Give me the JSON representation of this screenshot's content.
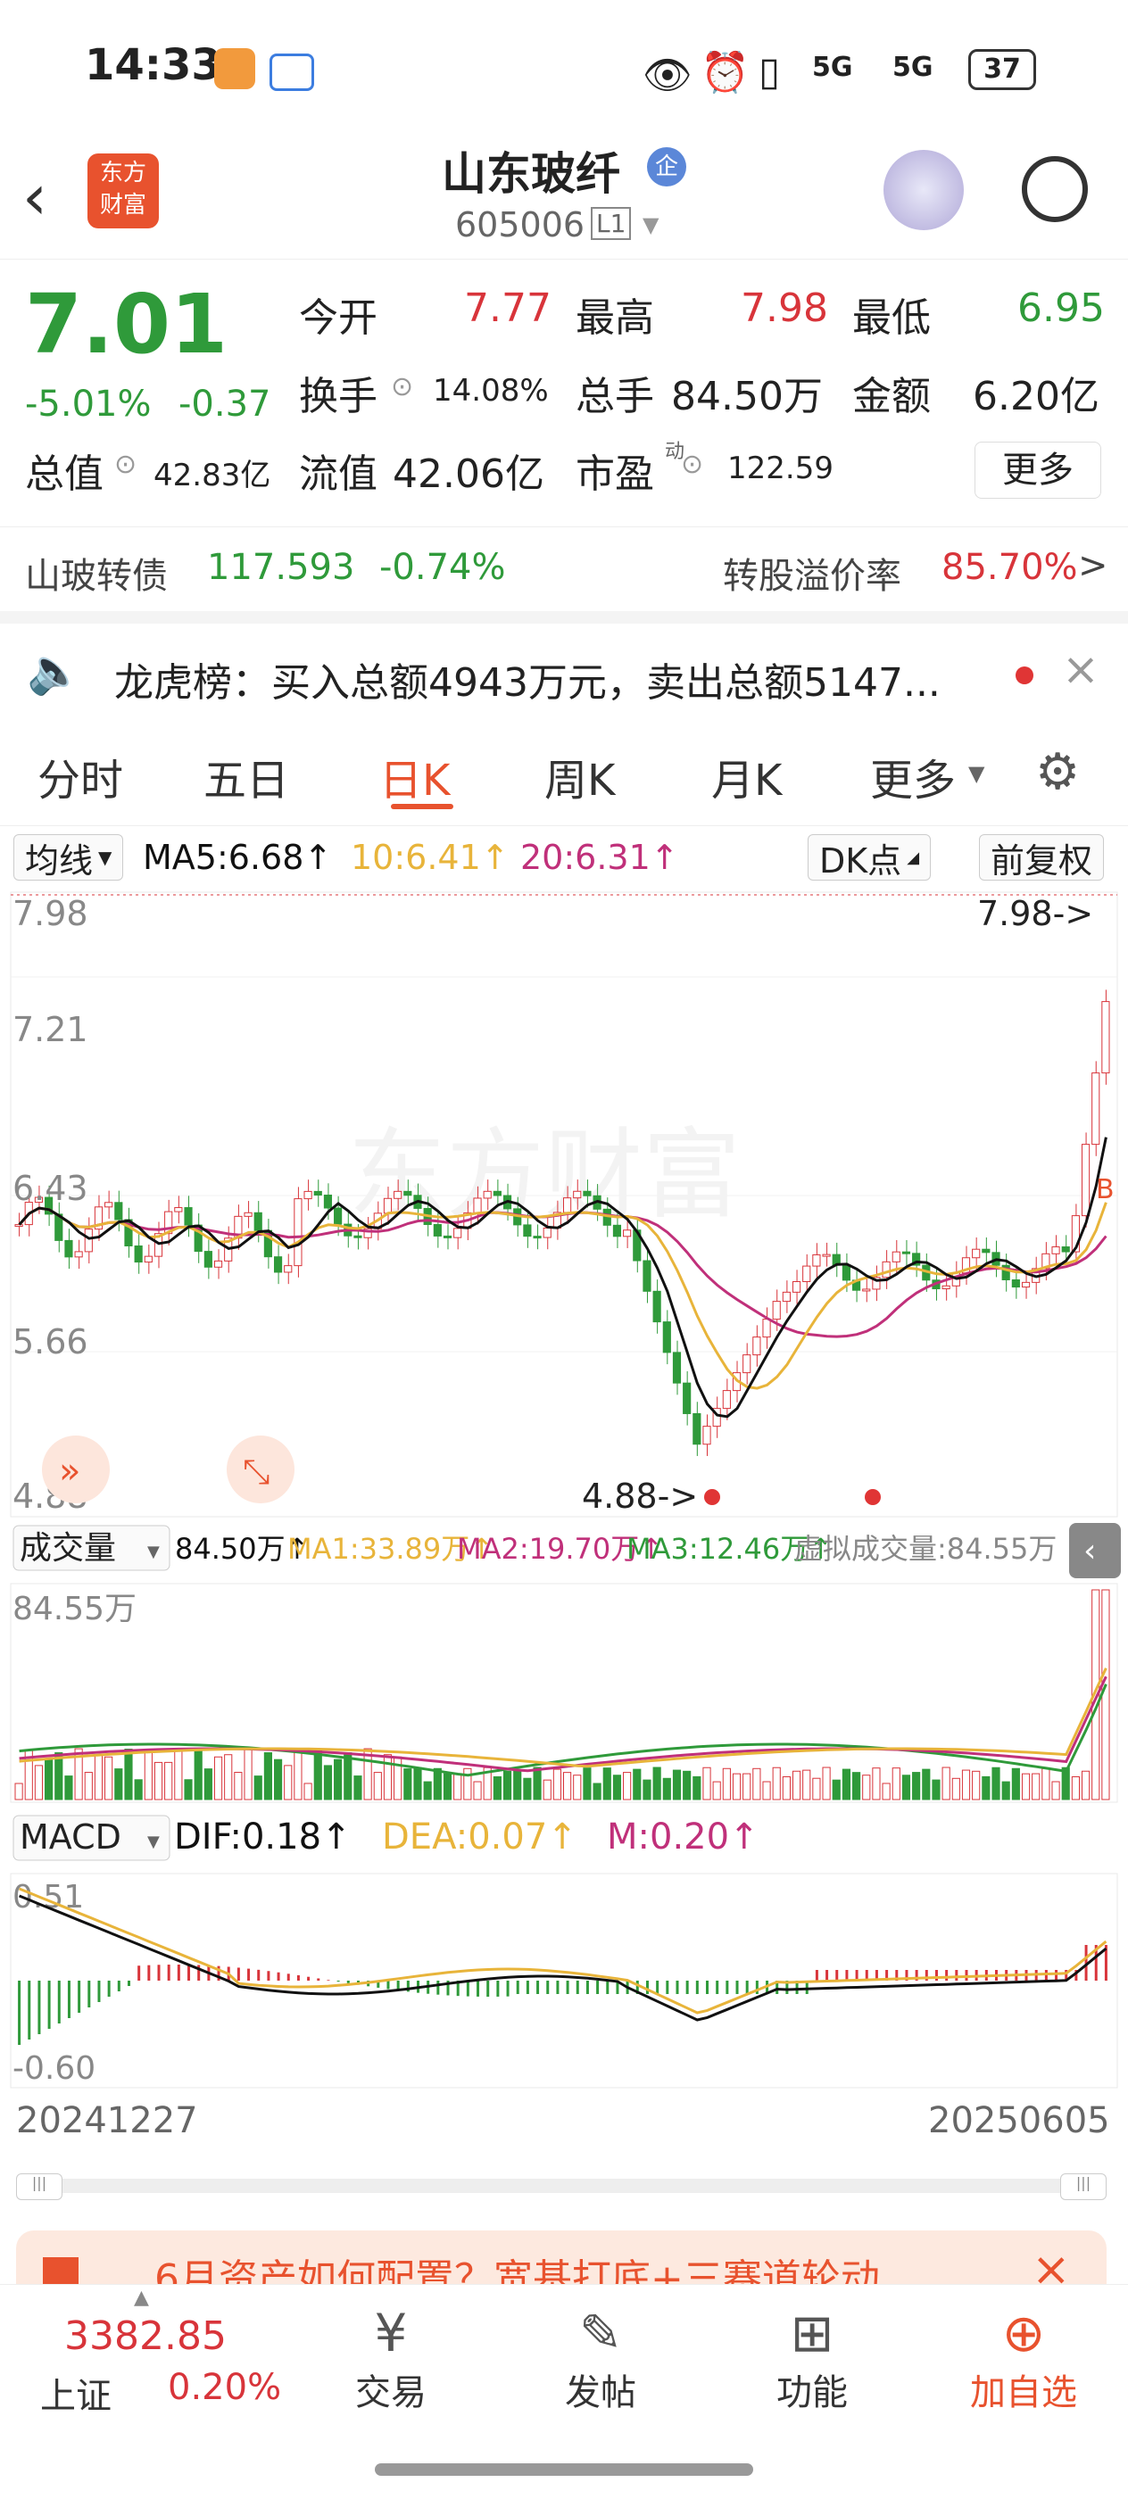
{
  "status": {
    "time": "14:33",
    "battery": "37",
    "signal1": "5G",
    "signal2": "5G"
  },
  "header": {
    "stock_name": "山东玻纤",
    "badge": "企",
    "code": "605006",
    "level": "L1",
    "logo_line1": "东方",
    "logo_line2": "财富"
  },
  "quote": {
    "price": "7.01",
    "change_pct": "-5.01%",
    "change": "-0.37",
    "open_label": "今开",
    "open": "7.77",
    "high_label": "最高",
    "high": "7.98",
    "low_label": "最低",
    "low": "6.95",
    "turnover_label": "换手",
    "turnover": "14.08%",
    "volume_label": "总手",
    "volume": "84.50万",
    "amount_label": "金额",
    "amount": "6.20亿",
    "mcap_label": "总值",
    "mcap": "42.83亿",
    "float_label": "流值",
    "float": "42.06亿",
    "pe_label": "市盈",
    "pe_sup": "动",
    "pe": "122.59",
    "more": "更多"
  },
  "bond": {
    "name": "山玻转债",
    "price": "117.593",
    "change": "-0.74%",
    "premium_label": "转股溢价率",
    "premium": "85.70%",
    "arrow": ">"
  },
  "notice": {
    "text": "龙虎榜：买入总额4943万元，卖出总额5147..."
  },
  "tabs": [
    "分时",
    "五日",
    "日K",
    "周K",
    "月K",
    "更多"
  ],
  "kline": {
    "ma_label": "均线",
    "ma5": "MA5:6.68↑",
    "ma10": "10:6.41↑",
    "ma20": "20:6.31↑",
    "dk": "DK点",
    "fq": "前复权",
    "y_top": "7.98",
    "y2": "7.21",
    "y3": "6.43",
    "y4": "5.66",
    "y_bottom": "4.88",
    "max_mark": "7.98->",
    "min_mark": "4.88->",
    "watermark": "东方财富",
    "b_mark": "B"
  },
  "volume": {
    "label": "成交量",
    "v": "84.50万↑",
    "ma1": "MA1:33.89万↑",
    "ma2": "MA2:19.70万↑",
    "ma3": "MA3:12.46万↑",
    "virtual": "虚拟成交量:84.55万",
    "top": "84.55万"
  },
  "macd": {
    "label": "MACD",
    "dif": "DIF:0.18↑",
    "dea": "DEA:0.07↑",
    "m": "M:0.20↑",
    "top": "0.51",
    "bottom": "-0.60"
  },
  "dates": {
    "start": "20241227",
    "end": "20250605"
  },
  "banner": {
    "text": "6月资产如何配置？宽基打底+三赛道轮动"
  },
  "bottom": {
    "index_value": "3382.85",
    "index_name": "上证",
    "index_change": "0.20%",
    "nav": [
      "交易",
      "发帖",
      "功能",
      "加自选"
    ]
  },
  "colors": {
    "red": "#d8343a",
    "green": "#2f9a3a",
    "ma5": "#111111",
    "ma10": "#e8b43a",
    "ma20": "#c0307a",
    "accent": "#e8522e"
  }
}
